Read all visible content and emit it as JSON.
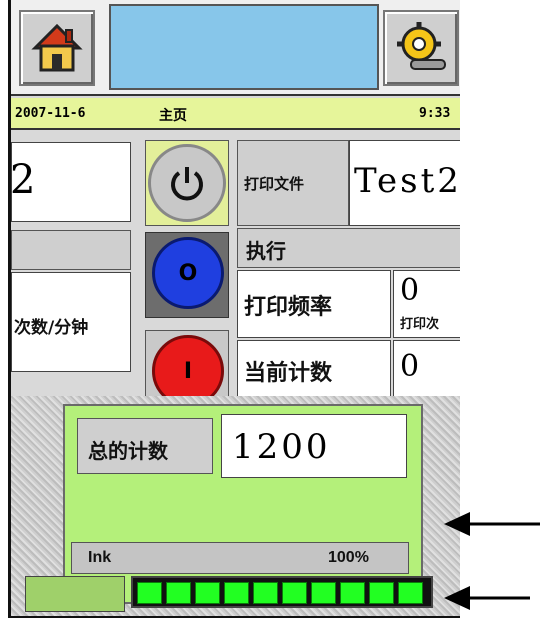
{
  "status": {
    "date": "2007-11-6",
    "page": "主页",
    "time": "9:33"
  },
  "left_panel": {
    "value": "2",
    "unit": "次数/分钟"
  },
  "file_row": {
    "label": "打印文件",
    "value": "Test2"
  },
  "exec_label": "执行",
  "freq_row": {
    "label": "打印频率",
    "value": "0",
    "sub_label": "打印次"
  },
  "count_row": {
    "label": "当前计数",
    "value": "0"
  },
  "total_row": {
    "label": "总的计数",
    "value": "1200"
  },
  "ink": {
    "label": "Ink",
    "percent_text": "100%",
    "level": 1.0,
    "segments": 10
  },
  "colors": {
    "status_bar": "#e6f59a",
    "title_bar": "#87c6ea",
    "ink_green": "#22ff22",
    "panel_green": "#8aff5a"
  },
  "icons": [
    "home-icon",
    "settings-icon",
    "power-icon",
    "start-button-icon",
    "stop-button-icon"
  ]
}
